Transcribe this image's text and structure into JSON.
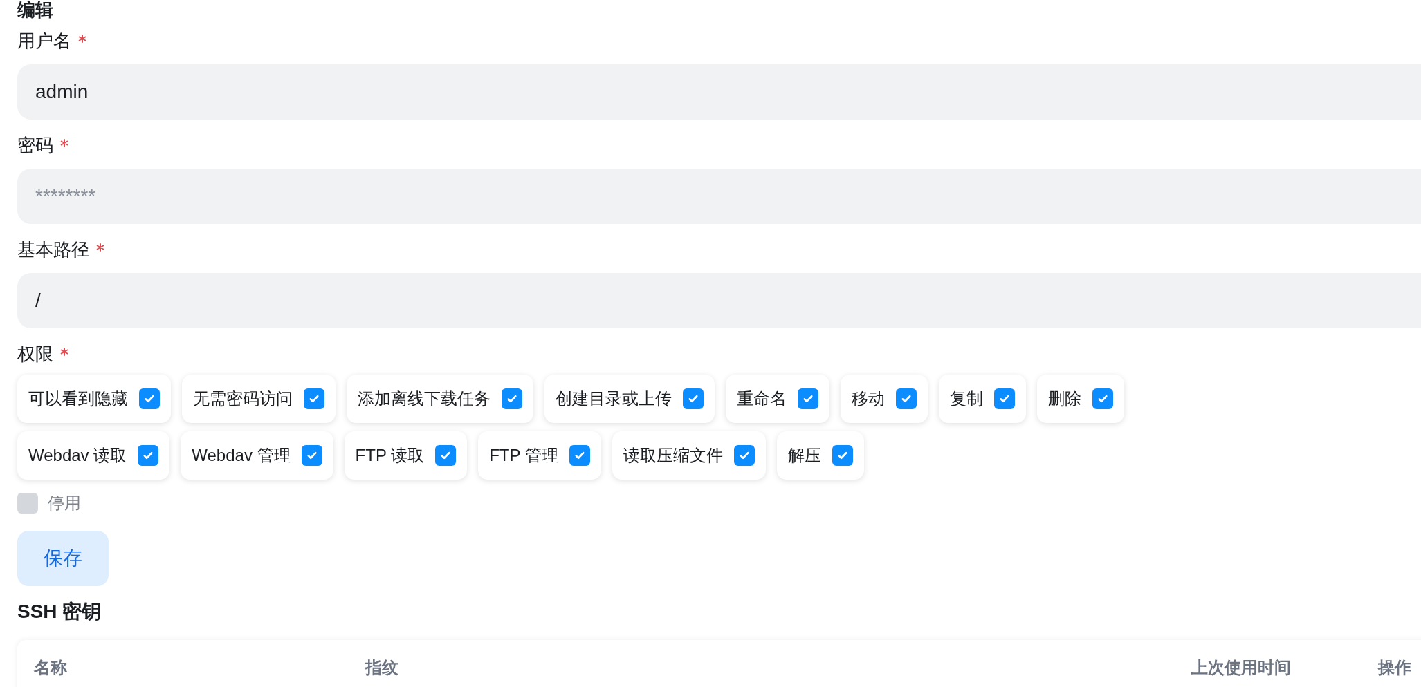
{
  "title": "编辑",
  "fields": [
    {
      "label": "用户名",
      "required": true,
      "value": "admin"
    },
    {
      "label": "密码",
      "required": true,
      "placeholder": "********"
    },
    {
      "label": "基本路径",
      "required": true,
      "value": "/"
    }
  ],
  "permissions": {
    "label": "权限",
    "required": true,
    "rows": [
      [
        {
          "label": "可以看到隐藏",
          "checked": true
        },
        {
          "label": "无需密码访问",
          "checked": true
        },
        {
          "label": "添加离线下载任务",
          "checked": true
        },
        {
          "label": "创建目录或上传",
          "checked": true
        },
        {
          "label": "重命名",
          "checked": true
        },
        {
          "label": "移动",
          "checked": true
        },
        {
          "label": "复制",
          "checked": true
        },
        {
          "label": "删除",
          "checked": true
        }
      ],
      [
        {
          "label": "Webdav 读取",
          "checked": true
        },
        {
          "label": "Webdav 管理",
          "checked": true
        },
        {
          "label": "FTP 读取",
          "checked": true
        },
        {
          "label": "FTP 管理",
          "checked": true
        },
        {
          "label": "读取压缩文件",
          "checked": true
        },
        {
          "label": "解压",
          "checked": true
        }
      ]
    ]
  },
  "disabled_option": {
    "label": "停用",
    "checked": false
  },
  "save_button": "保存",
  "ssh_keys": {
    "title": "SSH 密钥",
    "columns": [
      "名称",
      "指纹",
      "上次使用时间",
      "操作"
    ]
  }
}
